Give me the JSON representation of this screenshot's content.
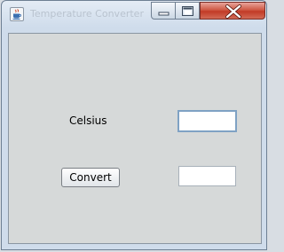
{
  "window": {
    "title": "Temperature Converter",
    "icon": "java-coffee-cup-icon",
    "controls": {
      "minimize_icon": "minimize-icon",
      "maximize_icon": "maximize-icon",
      "close_icon": "close-icon"
    }
  },
  "form": {
    "celsius_label": "Celsius",
    "celsius_value": "",
    "convert_label": "Convert",
    "result_value": ""
  },
  "colors": {
    "content_background": "#d6d9d9",
    "close_button": "#c23a26",
    "focus_border": "#7fa2c4"
  }
}
